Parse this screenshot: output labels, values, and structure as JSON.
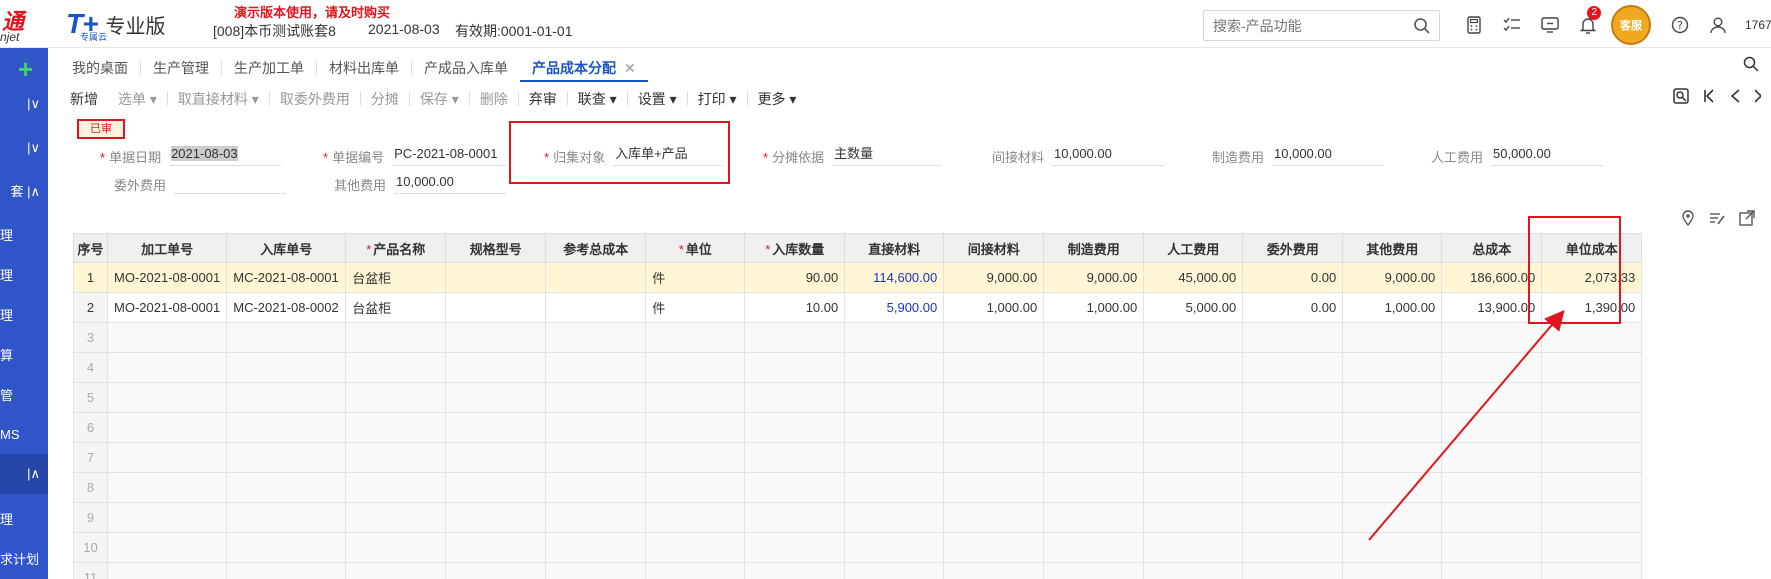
{
  "header": {
    "corner_logo_top": "通",
    "corner_logo_bottom": "njet",
    "brand_name": "T+",
    "brand_sub": "专属云",
    "edition": "专业版",
    "demo_notice": "演示版本使用，请及时购买",
    "account": "[008]本币测试账套8",
    "date": "2021-08-03",
    "validity": "有效期:0001-01-01",
    "search_placeholder": "搜索-产品功能",
    "notification_count": "2",
    "service_label": "客服",
    "user_id": "1767"
  },
  "sidebar": {
    "plus": "+",
    "items": [
      "理",
      "理",
      "理",
      "算",
      "管",
      "MS",
      "理",
      "求计划"
    ],
    "chevron_rows": [
      "|∨",
      "|∨",
      "套 |∧",
      "|∧"
    ]
  },
  "tabs": [
    {
      "label": "我的桌面"
    },
    {
      "label": "生产管理"
    },
    {
      "label": "生产加工单"
    },
    {
      "label": "材料出库单"
    },
    {
      "label": "产成品入库单"
    },
    {
      "label": "产品成本分配",
      "close": "✕"
    }
  ],
  "toolbar": {
    "items": [
      {
        "label": "新增",
        "disabled": false
      },
      {
        "label": "选单 ▾",
        "disabled": true
      },
      {
        "label": "取直接材料 ▾",
        "disabled": true
      },
      {
        "label": "取委外费用",
        "disabled": true
      },
      {
        "label": "分摊",
        "disabled": true
      },
      {
        "label": "保存 ▾",
        "disabled": true
      },
      {
        "label": "删除",
        "disabled": true
      },
      {
        "label": "弃审",
        "disabled": false
      },
      {
        "label": "联查 ▾",
        "disabled": false
      },
      {
        "label": "设置 ▾",
        "disabled": false
      },
      {
        "label": "打印 ▾",
        "disabled": false
      },
      {
        "label": "更多 ▾",
        "disabled": false
      }
    ]
  },
  "form": {
    "status": "已审",
    "doc_date_label": "单据日期",
    "doc_date": "2021-08-03",
    "doc_no_label": "单据编号",
    "doc_no": "PC-2021-08-0001",
    "collect_label": "归集对象",
    "collect": "入库单+产品",
    "alloc_label": "分摊依据",
    "alloc": "主数量",
    "indirect_label": "间接材料",
    "indirect": "10,000.00",
    "mfg_label": "制造费用",
    "mfg": "10,000.00",
    "labor_label": "人工费用",
    "labor": "50,000.00",
    "outsource_label": "委外费用",
    "outsource": "",
    "other_label": "其他费用",
    "other": "10,000.00"
  },
  "table": {
    "headers": [
      {
        "label": "序号",
        "req": false
      },
      {
        "label": "加工单号",
        "req": false
      },
      {
        "label": "入库单号",
        "req": false
      },
      {
        "label": "产品名称",
        "req": true
      },
      {
        "label": "规格型号",
        "req": false
      },
      {
        "label": "参考总成本",
        "req": false
      },
      {
        "label": "单位",
        "req": true
      },
      {
        "label": "入库数量",
        "req": true
      },
      {
        "label": "直接材料",
        "req": false
      },
      {
        "label": "间接材料",
        "req": false
      },
      {
        "label": "制造费用",
        "req": false
      },
      {
        "label": "人工费用",
        "req": false
      },
      {
        "label": "委外费用",
        "req": false
      },
      {
        "label": "其他费用",
        "req": false
      },
      {
        "label": "总成本",
        "req": false
      },
      {
        "label": "单位成本",
        "req": false
      }
    ],
    "rows": [
      [
        "1",
        "MO-2021-08-0001",
        "MC-2021-08-0001",
        "台盆柜",
        "",
        "",
        "件",
        "90.00",
        "114,600.00",
        "9,000.00",
        "9,000.00",
        "45,000.00",
        "0.00",
        "9,000.00",
        "186,600.00",
        "2,073.33"
      ],
      [
        "2",
        "MO-2021-08-0001",
        "MC-2021-08-0002",
        "台盆柜",
        "",
        "",
        "件",
        "10.00",
        "5,900.00",
        "1,000.00",
        "1,000.00",
        "5,000.00",
        "0.00",
        "1,000.00",
        "13,900.00",
        "1,390.00"
      ]
    ],
    "empty_rows": [
      "3",
      "4",
      "5",
      "6",
      "7",
      "8",
      "9",
      "10",
      "11"
    ]
  },
  "colors": {
    "brand_blue": "#1a55c8",
    "sidebar_blue": "#2f55c8",
    "highlight_red": "#e0161e",
    "selected_row": "#fff6d5",
    "link_blue": "#1a33c8"
  },
  "icons": {
    "top": [
      "calculator-icon",
      "checklist-icon",
      "message-icon",
      "bell-icon",
      "help-icon",
      "user-icon"
    ],
    "toolbar_right": [
      "preview-search-icon",
      "first-page-icon",
      "prev-page-icon",
      "next-page-icon"
    ],
    "grid": [
      "location-icon",
      "edit-columns-icon",
      "export-icon"
    ]
  }
}
